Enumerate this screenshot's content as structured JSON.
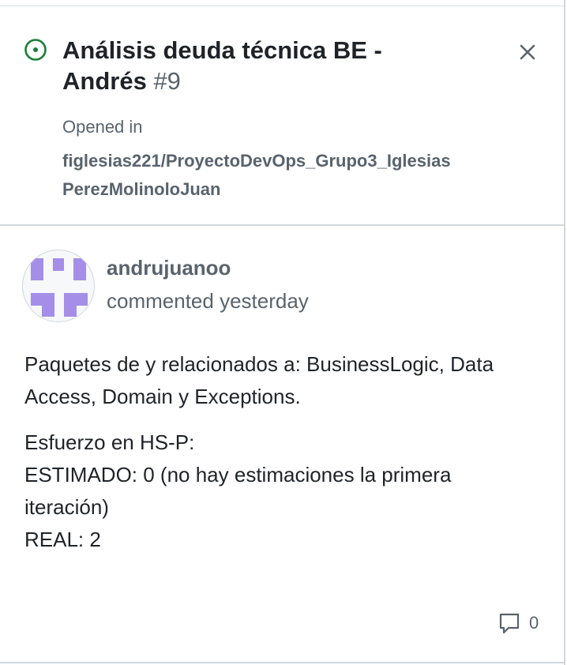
{
  "issue": {
    "title": "Análisis deuda técnica BE - Andrés",
    "number": "#9",
    "status_color": "#1a7f37",
    "opened_in_label": "Opened in",
    "repository": "figlesias221/ProyectoDevOps_Grupo3_IglesiasPerezMolinoloJuan"
  },
  "comment": {
    "author": "andrujuanoo",
    "meta": "commented yesterday",
    "avatar_color": "#a58ee8",
    "paragraphs": [
      "Paquetes de y relacionados a: BusinessLogic, Data Access, Domain y Exceptions.",
      ""
    ],
    "effort_lines": [
      "Esfuerzo en HS-P:",
      "ESTIMADO: 0 (no hay estimaciones la primera iteración)",
      "REAL: 2"
    ],
    "comment_count": "0"
  }
}
